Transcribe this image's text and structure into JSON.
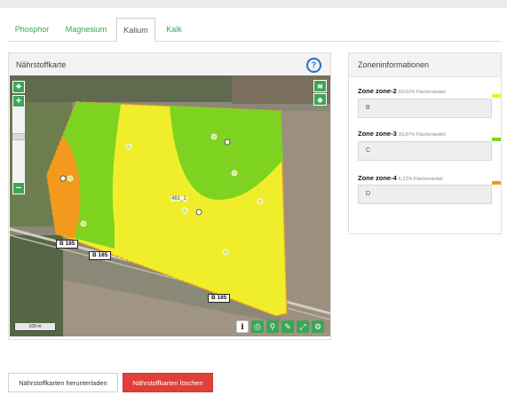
{
  "tabs": [
    {
      "label": "Phosphor",
      "active": false
    },
    {
      "label": "Magnesium",
      "active": false
    },
    {
      "label": "Kalium",
      "active": true
    },
    {
      "label": "Kalk",
      "active": false
    }
  ],
  "map_panel": {
    "title": "Nährstoffkarte",
    "help_icon": "?",
    "controls": {
      "locate": "⌖",
      "zoom_in": "+",
      "zoom_out": "−"
    },
    "layer_icons": [
      "layers-icon",
      "tag-icon"
    ],
    "roads": [
      "B 185",
      "B 185",
      "B 185"
    ],
    "field_label": "461_1",
    "scale_text": "100 m",
    "toolbar": [
      "info-icon",
      "print-icon",
      "pin-icon",
      "pencil-icon",
      "expand-icon",
      "settings-icon"
    ],
    "toolbar_glyphs": [
      "i",
      "⎙",
      "⚲",
      "✎",
      "⤢",
      "⚙"
    ]
  },
  "zone_panel": {
    "title": "Zoneninformationen",
    "zones": [
      {
        "name": "Zone zone-2",
        "share": "60,01% Flächenanteil",
        "value": "B",
        "color": "#f0ee2a"
      },
      {
        "name": "Zone zone-3",
        "share": "33,87% Flächenanteil",
        "value": "C",
        "color": "#7ed321"
      },
      {
        "name": "Zone zone-4",
        "share": "6,12% Flächenanteil",
        "value": "D",
        "color": "#f39a1e"
      }
    ]
  },
  "buttons": {
    "download": "Nährstoffkarten herunterladen",
    "delete": "Nährstoffkarten löschen"
  },
  "colors": {
    "accent": "#3aa655",
    "danger": "#e0403a"
  }
}
